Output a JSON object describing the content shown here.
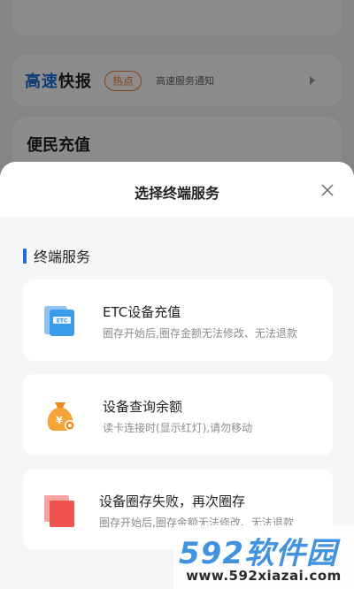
{
  "background": {
    "news_card": {
      "title_part1": "高速",
      "title_part2": "快报",
      "badge": "热点",
      "subtitle": "高速服务通知"
    },
    "recharge_card": {
      "title": "便民充值"
    }
  },
  "sheet": {
    "title": "选择终端服务",
    "section_title": "终端服务",
    "services": [
      {
        "title": "ETC设备充值",
        "desc": "圈存开始后,圈存金额无法修改、无法退款",
        "icon": "etc-card-icon"
      },
      {
        "title": "设备查询余额",
        "desc": "读卡连接时(显示红灯),请勿移动",
        "icon": "money-bag-icon"
      },
      {
        "title": "设备圈存失败，再次圈存",
        "desc": "圈存开始后,圈存金额无法修改、无法退款",
        "icon": "retry-squares-icon"
      }
    ]
  },
  "watermark": {
    "logo_num": "592",
    "logo_text": "软件园",
    "url": "www.592xiazai.com"
  },
  "colors": {
    "accent": "#1a6fd8",
    "hot": "#f07a2b",
    "etc_blue": "#3a9be8",
    "coin_orange": "#f08a1c",
    "retry_red": "#ef5350"
  }
}
